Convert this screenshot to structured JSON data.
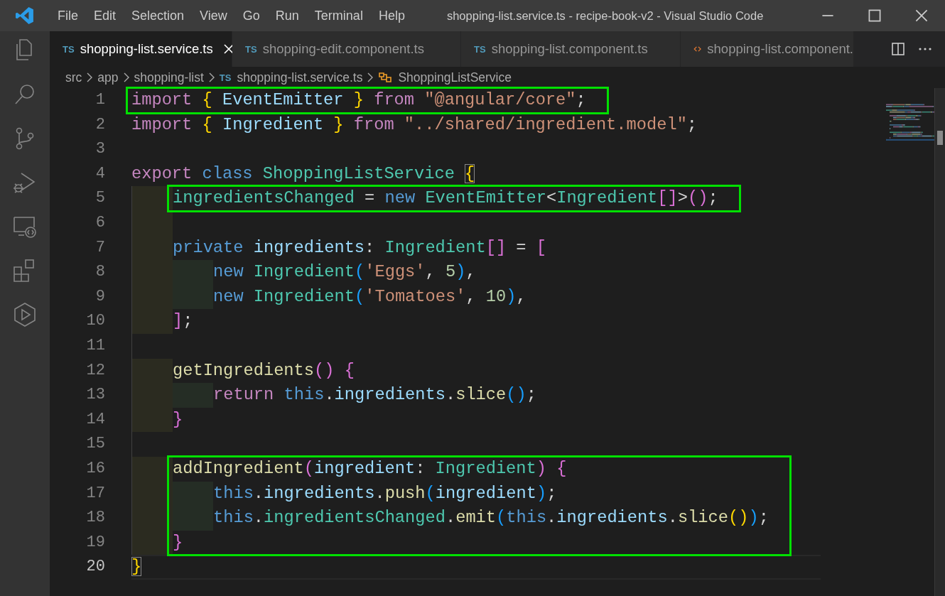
{
  "window": {
    "title": "shopping-list.service.ts - recipe-book-v2 - Visual Studio Code"
  },
  "menu": [
    "File",
    "Edit",
    "Selection",
    "View",
    "Go",
    "Run",
    "Terminal",
    "Help"
  ],
  "tabs": [
    {
      "kind": "ts",
      "badge": "TS",
      "label": "shopping-list.service.ts",
      "selected": true
    },
    {
      "kind": "ts",
      "badge": "TS",
      "label": "shopping-edit.component.ts",
      "selected": false
    },
    {
      "kind": "ts",
      "badge": "TS",
      "label": "shopping-list.component.ts",
      "selected": false
    },
    {
      "kind": "html",
      "label": "shopping-list.component.",
      "selected": false
    }
  ],
  "breadcrumb": [
    {
      "kind": "folder",
      "label": "src"
    },
    {
      "kind": "folder",
      "label": "app"
    },
    {
      "kind": "folder",
      "label": "shopping-list"
    },
    {
      "kind": "file",
      "badge": "TS",
      "label": "shopping-list.service.ts"
    },
    {
      "kind": "symbol",
      "label": "ShoppingListService"
    }
  ],
  "lines": [
    {
      "number": "1",
      "boxed": true,
      "current": false,
      "shaded": false,
      "tokens": [
        {
          "kind": "keyword",
          "text": "import "
        },
        {
          "kind": "bracket1",
          "text": "{"
        },
        {
          "kind": "variable",
          "text": " EventEmitter "
        },
        {
          "kind": "bracket1",
          "text": "}"
        },
        {
          "kind": "keyword",
          "text": " from "
        },
        {
          "kind": "string",
          "text": "\"@angular/core\""
        },
        {
          "kind": "plain",
          "text": ";"
        }
      ]
    },
    {
      "number": "2",
      "boxed": false,
      "current": false,
      "shaded": false,
      "tokens": [
        {
          "kind": "keyword",
          "text": "import "
        },
        {
          "kind": "bracket1",
          "text": "{"
        },
        {
          "kind": "variable",
          "text": " Ingredient "
        },
        {
          "kind": "bracket1",
          "text": "}"
        },
        {
          "kind": "keyword",
          "text": " from "
        },
        {
          "kind": "string",
          "text": "\"../shared/ingredient.model\""
        },
        {
          "kind": "plain",
          "text": ";"
        }
      ]
    },
    {
      "number": "3",
      "boxed": false,
      "current": false,
      "shaded": false
    },
    {
      "number": "4",
      "boxed": false,
      "current": false,
      "shaded": false,
      "tokens": [
        {
          "kind": "keyword",
          "text": "export "
        },
        {
          "kind": "storage",
          "text": "class "
        },
        {
          "kind": "class",
          "text": "ShoppingListService "
        },
        {
          "kind": "bracket1",
          "text": "{",
          "matched": true
        }
      ],
      "children": [
        {
          "number": "5",
          "boxed": true,
          "current": false,
          "shaded": true,
          "tokens": [
            {
              "kind": "class",
              "text": "ingredientsChanged"
            },
            {
              "kind": "plain",
              "text": " = "
            },
            {
              "kind": "storage",
              "text": "new "
            },
            {
              "kind": "class",
              "text": "EventEmitter"
            },
            {
              "kind": "plain",
              "text": "<"
            },
            {
              "kind": "class",
              "text": "Ingredient"
            },
            {
              "kind": "bracket2",
              "text": "[]"
            },
            {
              "kind": "plain",
              "text": ">"
            },
            {
              "kind": "bracket2",
              "text": "()"
            },
            {
              "kind": "plain",
              "text": ";"
            }
          ]
        },
        {
          "number": "6",
          "boxed": false,
          "current": false,
          "shaded": true
        },
        {
          "number": "7",
          "boxed": false,
          "current": false,
          "shaded": true,
          "tokens": [
            {
              "kind": "storage",
              "text": "private "
            },
            {
              "kind": "variable",
              "text": "ingredients"
            },
            {
              "kind": "plain",
              "text": ": "
            },
            {
              "kind": "class",
              "text": "Ingredient"
            },
            {
              "kind": "bracket2",
              "text": "[]"
            },
            {
              "kind": "plain",
              "text": " = "
            },
            {
              "kind": "bracket2",
              "text": "["
            }
          ],
          "children": [
            {
              "number": "8",
              "boxed": false,
              "current": false,
              "shaded": true,
              "tokens": [
                {
                  "kind": "storage",
                  "text": "new "
                },
                {
                  "kind": "class",
                  "text": "Ingredient"
                },
                {
                  "kind": "bracket3",
                  "text": "("
                },
                {
                  "kind": "string",
                  "text": "'Eggs'"
                },
                {
                  "kind": "plain",
                  "text": ", "
                },
                {
                  "kind": "number",
                  "text": "5"
                },
                {
                  "kind": "bracket3",
                  "text": ")"
                },
                {
                  "kind": "plain",
                  "text": ","
                }
              ]
            },
            {
              "number": "9",
              "boxed": false,
              "current": false,
              "shaded": true,
              "tokens": [
                {
                  "kind": "storage",
                  "text": "new "
                },
                {
                  "kind": "class",
                  "text": "Ingredient"
                },
                {
                  "kind": "bracket3",
                  "text": "("
                },
                {
                  "kind": "string",
                  "text": "'Tomatoes'"
                },
                {
                  "kind": "plain",
                  "text": ", "
                },
                {
                  "kind": "number",
                  "text": "10"
                },
                {
                  "kind": "bracket3",
                  "text": ")"
                },
                {
                  "kind": "plain",
                  "text": ","
                }
              ]
            }
          ]
        },
        {
          "number": "10",
          "boxed": false,
          "current": false,
          "shaded": true,
          "tokens": [
            {
              "kind": "bracket2",
              "text": "]"
            },
            {
              "kind": "plain",
              "text": ";"
            }
          ]
        },
        {
          "number": "11",
          "boxed": false,
          "current": false,
          "shaded": false
        },
        {
          "number": "12",
          "boxed": false,
          "current": false,
          "shaded": true,
          "tokens": [
            {
              "kind": "func",
              "text": "getIngredients"
            },
            {
              "kind": "bracket2",
              "text": "()"
            },
            {
              "kind": "bracket2",
              "text": " {"
            }
          ],
          "children": [
            {
              "number": "13",
              "boxed": false,
              "current": false,
              "shaded": true,
              "tokens": [
                {
                  "kind": "keyword",
                  "text": "return "
                },
                {
                  "kind": "storage",
                  "text": "this"
                },
                {
                  "kind": "plain",
                  "text": "."
                },
                {
                  "kind": "variable",
                  "text": "ingredients"
                },
                {
                  "kind": "plain",
                  "text": "."
                },
                {
                  "kind": "func",
                  "text": "slice"
                },
                {
                  "kind": "bracket3",
                  "text": "()"
                },
                {
                  "kind": "plain",
                  "text": ";"
                }
              ]
            }
          ]
        },
        {
          "number": "14",
          "boxed": false,
          "current": false,
          "shaded": true,
          "tokens": [
            {
              "kind": "bracket2",
              "text": "}"
            }
          ]
        },
        {
          "number": "15",
          "boxed": false,
          "current": false,
          "shaded": false
        },
        {
          "number": "16",
          "boxed": true,
          "current": false,
          "shaded": true,
          "tokens": [
            {
              "kind": "func",
              "text": "addIngredient"
            },
            {
              "kind": "bracket2",
              "text": "("
            },
            {
              "kind": "variable",
              "text": "ingredient"
            },
            {
              "kind": "plain",
              "text": ": "
            },
            {
              "kind": "class",
              "text": "Ingredient"
            },
            {
              "kind": "bracket2",
              "text": ")"
            },
            {
              "kind": "bracket2",
              "text": " {"
            }
          ],
          "children": [
            {
              "number": "17",
              "boxed": true,
              "current": false,
              "shaded": true,
              "tokens": [
                {
                  "kind": "storage",
                  "text": "this"
                },
                {
                  "kind": "plain",
                  "text": "."
                },
                {
                  "kind": "variable",
                  "text": "ingredients"
                },
                {
                  "kind": "plain",
                  "text": "."
                },
                {
                  "kind": "func",
                  "text": "push"
                },
                {
                  "kind": "bracket3",
                  "text": "("
                },
                {
                  "kind": "variable",
                  "text": "ingredient"
                },
                {
                  "kind": "bracket3",
                  "text": ")"
                },
                {
                  "kind": "plain",
                  "text": ";"
                }
              ]
            },
            {
              "number": "18",
              "boxed": true,
              "current": false,
              "shaded": true,
              "tokens": [
                {
                  "kind": "storage",
                  "text": "this"
                },
                {
                  "kind": "plain",
                  "text": "."
                },
                {
                  "kind": "class",
                  "text": "ingredientsChanged"
                },
                {
                  "kind": "plain",
                  "text": "."
                },
                {
                  "kind": "func",
                  "text": "emit"
                },
                {
                  "kind": "bracket3",
                  "text": "("
                },
                {
                  "kind": "storage",
                  "text": "this"
                },
                {
                  "kind": "plain",
                  "text": "."
                },
                {
                  "kind": "variable",
                  "text": "ingredients"
                },
                {
                  "kind": "plain",
                  "text": "."
                },
                {
                  "kind": "func",
                  "text": "slice"
                },
                {
                  "kind": "bracket1",
                  "text": "()"
                },
                {
                  "kind": "bracket3",
                  "text": ")"
                },
                {
                  "kind": "plain",
                  "text": ";"
                }
              ]
            }
          ]
        },
        {
          "number": "19",
          "boxed": true,
          "current": false,
          "shaded": true,
          "tokens": [
            {
              "kind": "bracket2",
              "text": "}"
            }
          ]
        }
      ]
    },
    {
      "number": "20",
      "boxed": false,
      "current": true,
      "shaded": false,
      "tokens": [
        {
          "kind": "bracket1",
          "text": "}",
          "matched": true
        }
      ]
    }
  ]
}
